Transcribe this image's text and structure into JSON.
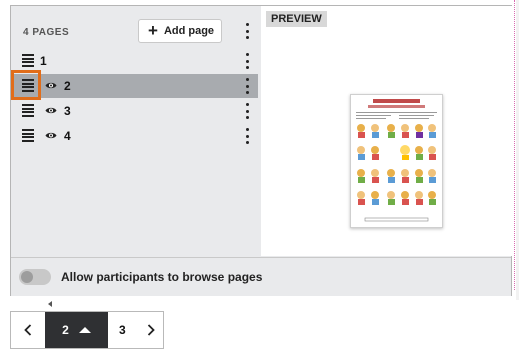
{
  "sidebar": {
    "page_count_label": "4 PAGES",
    "add_page_label": "Add page",
    "pages": [
      {
        "number": "1",
        "visible_icon": false,
        "active": false
      },
      {
        "number": "2",
        "visible_icon": true,
        "active": true
      },
      {
        "number": "3",
        "visible_icon": true,
        "active": false
      },
      {
        "number": "4",
        "visible_icon": true,
        "active": false
      }
    ]
  },
  "preview": {
    "label": "PREVIEW"
  },
  "footer": {
    "toggle_label": "Allow participants to browse pages",
    "toggle_on": false
  },
  "pager": {
    "current": "2",
    "next": "3"
  },
  "colors": {
    "active_row": "#a8abaf",
    "drag_highlight": "#e16d1a",
    "pager_current_bg": "#2f3033"
  },
  "icons": [
    "plus-icon",
    "kebab-menu-icon",
    "drag-handle-icon",
    "eye-icon",
    "chevron-left-icon",
    "chevron-right-icon",
    "caret-up-icon"
  ]
}
